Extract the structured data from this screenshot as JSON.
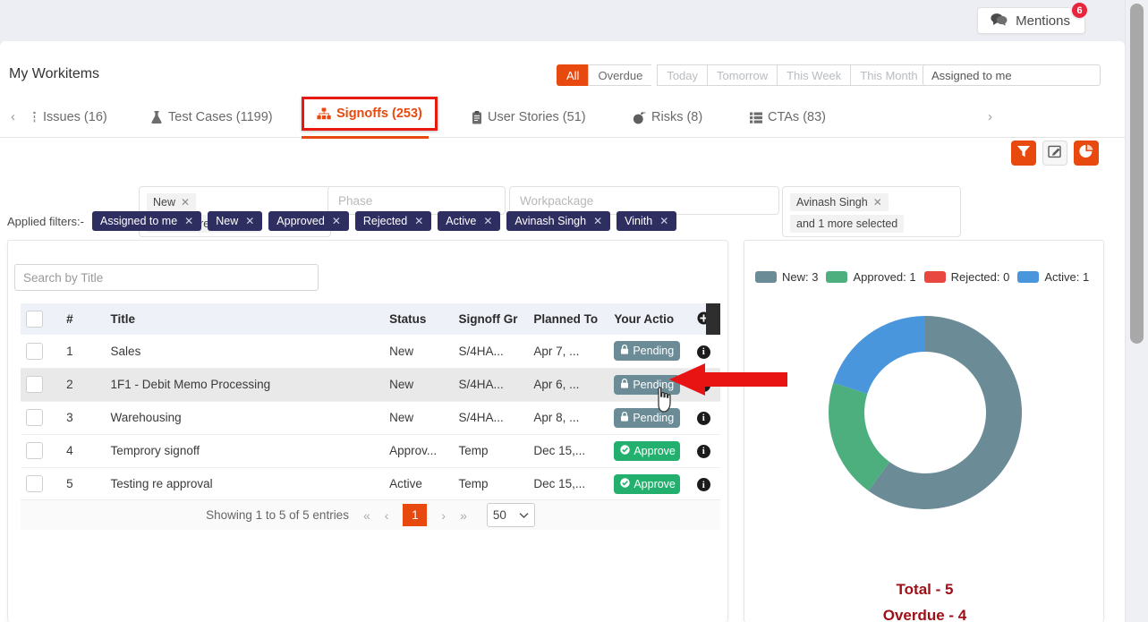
{
  "topbar": {
    "mentions_label": "Mentions",
    "mentions_icon": "comments-icon",
    "mentions_count": "6"
  },
  "header": {
    "title": "My Workitems",
    "range_buttons": [
      {
        "label": "All",
        "state": "active"
      },
      {
        "label": "Overdue",
        "state": "normal"
      },
      {
        "label": "Today",
        "state": "disabled"
      },
      {
        "label": "Tomorrow",
        "state": "disabled"
      },
      {
        "label": "This Week",
        "state": "disabled"
      },
      {
        "label": "This Month",
        "state": "disabled"
      }
    ],
    "assigned_select": "Assigned to me"
  },
  "tabs": {
    "prev_arrow": "‹",
    "next_arrow": "›",
    "items": [
      {
        "label": "Issues (16)",
        "icon": "issues-icon",
        "selected": false
      },
      {
        "label": "Test Cases (1199)",
        "icon": "flask-icon",
        "selected": false
      },
      {
        "label": "Signoffs (253)",
        "icon": "sitemap-icon",
        "selected": true
      },
      {
        "label": "User Stories (51)",
        "icon": "clipboard-icon",
        "selected": false
      },
      {
        "label": "Risks (8)",
        "icon": "bomb-icon",
        "selected": false
      },
      {
        "label": "CTAs (83)",
        "icon": "list-icon",
        "selected": false
      }
    ],
    "tools": [
      {
        "name": "filter-icon",
        "style": "orange"
      },
      {
        "name": "edit-icon",
        "style": "light"
      },
      {
        "name": "chart-icon",
        "style": "orange"
      }
    ]
  },
  "filters": {
    "status": {
      "chips": [
        "New"
      ],
      "more": "and 3 more selected"
    },
    "phase_placeholder": "Phase",
    "workpackage_placeholder": "Workpackage",
    "assignee": {
      "chips": [
        "Avinash Singh"
      ],
      "more": "and 1 more selected"
    }
  },
  "applied_filters": {
    "label": "Applied filters:-",
    "chips": [
      "Assigned to me",
      "New",
      "Approved",
      "Rejected",
      "Active",
      "Avinash Singh",
      "Vinith"
    ]
  },
  "table": {
    "search_placeholder": "Search by Title",
    "columns": [
      "",
      "#",
      "Title",
      "Status",
      "Signoff Gr",
      "Planned To",
      "Your Actio",
      "add-column-icon"
    ],
    "rows": [
      {
        "num": "1",
        "title": "Sales",
        "status": "New",
        "group": "S/4HA...",
        "planned": "Apr 7, ...",
        "action": "Pending",
        "action_type": "pending"
      },
      {
        "num": "2",
        "title": "1F1 - Debit Memo Processing",
        "status": "New",
        "group": "S/4HA...",
        "planned": "Apr 6, ...",
        "action": "Pending",
        "action_type": "pending"
      },
      {
        "num": "3",
        "title": "Warehousing",
        "status": "New",
        "group": "S/4HA...",
        "planned": "Apr 8, ...",
        "action": "Pending",
        "action_type": "pending"
      },
      {
        "num": "4",
        "title": "Temprory signoff",
        "status": "Approv...",
        "group": "Temp",
        "planned": "Dec 15,...",
        "action": "Approve",
        "action_type": "approved"
      },
      {
        "num": "5",
        "title": "Testing re approval",
        "status": "Active",
        "group": "Temp",
        "planned": "Dec 15,...",
        "action": "Approve",
        "action_type": "approved"
      }
    ],
    "pagination": {
      "showing": "Showing 1 to 5 of 5 entries",
      "first": "«",
      "prev": "‹",
      "current_page": "1",
      "next": "›",
      "last": "»",
      "page_size": "50"
    }
  },
  "chart_data": {
    "type": "pie",
    "title": "",
    "variant": "donut",
    "categories": [
      "New",
      "Approved",
      "Rejected",
      "Active"
    ],
    "values": [
      3,
      1,
      0,
      1
    ],
    "colors": [
      "#6b8b96",
      "#4caf7d",
      "#e8483f",
      "#4a96dd"
    ],
    "legend": [
      {
        "label": "New: 3",
        "color": "#6b8b96"
      },
      {
        "label": "Approved: 1",
        "color": "#4caf7d"
      },
      {
        "label": "Rejected: 0",
        "color": "#e8483f"
      },
      {
        "label": "Active: 1",
        "color": "#4a96dd"
      }
    ],
    "legend_position": "top",
    "total_label": "Total - 5",
    "overdue_label": "Overdue - 4"
  }
}
